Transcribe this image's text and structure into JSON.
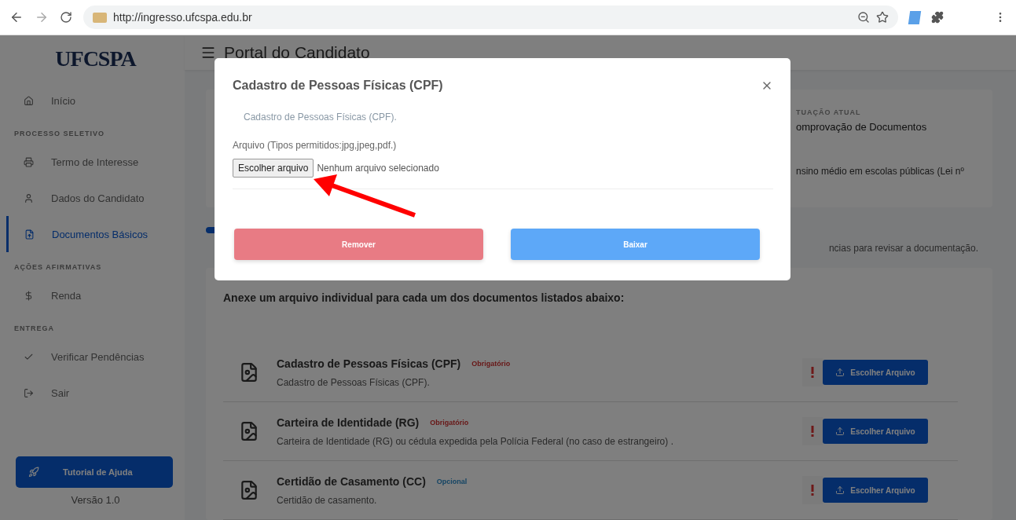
{
  "browser": {
    "url": "http://ingresso.ufcspa.edu.br"
  },
  "sidebar": {
    "logo": "UFCSPA",
    "items": [
      {
        "kind": "link",
        "label": "Início",
        "selected": false
      },
      {
        "kind": "section",
        "label": "PROCESSO SELETIVO"
      },
      {
        "kind": "link",
        "label": "Termo de Interesse",
        "selected": false
      },
      {
        "kind": "link",
        "label": "Dados do Candidato",
        "selected": false
      },
      {
        "kind": "link",
        "label": "Documentos Básicos",
        "selected": true
      },
      {
        "kind": "section",
        "label": "AÇÕES AFIRMATIVAS"
      },
      {
        "kind": "link",
        "label": "Renda",
        "selected": false
      },
      {
        "kind": "section",
        "label": "ENTREGA"
      },
      {
        "kind": "link",
        "label": "Verificar Pendências",
        "selected": false
      },
      {
        "kind": "link",
        "label": "Sair",
        "selected": false
      }
    ],
    "help_button": "Tutorial de Ajuda",
    "version": "Versão 1.0"
  },
  "header": {
    "title": "Portal do Candidato"
  },
  "status_card": {
    "label": "TUAÇÃO ATUAL",
    "value": "omprovação de Documentos",
    "note": "nsino médio em escolas públicas (Lei nº"
  },
  "progress": {
    "level": 0.02,
    "hint": "ncias para revisar a documentação."
  },
  "documents": {
    "heading": "Anexe um arquivo individual para cada um dos documentos listados abaixo:",
    "items": [
      {
        "title": "Cadastro de Pessoas Físicas (CPF)",
        "badge": "Obrigatório",
        "kind": "required",
        "description": "Cadastro de Pessoas Físicas (CPF).",
        "button": "Escolher Arquivo"
      },
      {
        "title": "Carteira de Identidade (RG)",
        "badge": "Obrigatório",
        "kind": "required",
        "description": "Carteira de Identidade (RG) ou cédula expedida pela Polícia Federal (no caso de estrangeiro) .",
        "button": "Escolher Arquivo"
      },
      {
        "title": "Certidão de Casamento (CC)",
        "badge": "Opcional",
        "kind": "optional",
        "description": "Certidão de casamento.",
        "button": "Escolher Arquivo"
      }
    ]
  },
  "modal": {
    "title": "Cadastro de Pessoas Físicas (CPF)",
    "description": "Cadastro de Pessoas Físicas (CPF).",
    "file_label": "Arquivo (Tipos permitidos:jpg,jpeg,pdf.)",
    "file_button": "Escolher arquivo",
    "file_status": "Nenhum arquivo selecionado",
    "buttons": [
      {
        "kind": "danger",
        "label": "Remover"
      },
      {
        "kind": "primary",
        "label": "Baixar"
      }
    ]
  }
}
